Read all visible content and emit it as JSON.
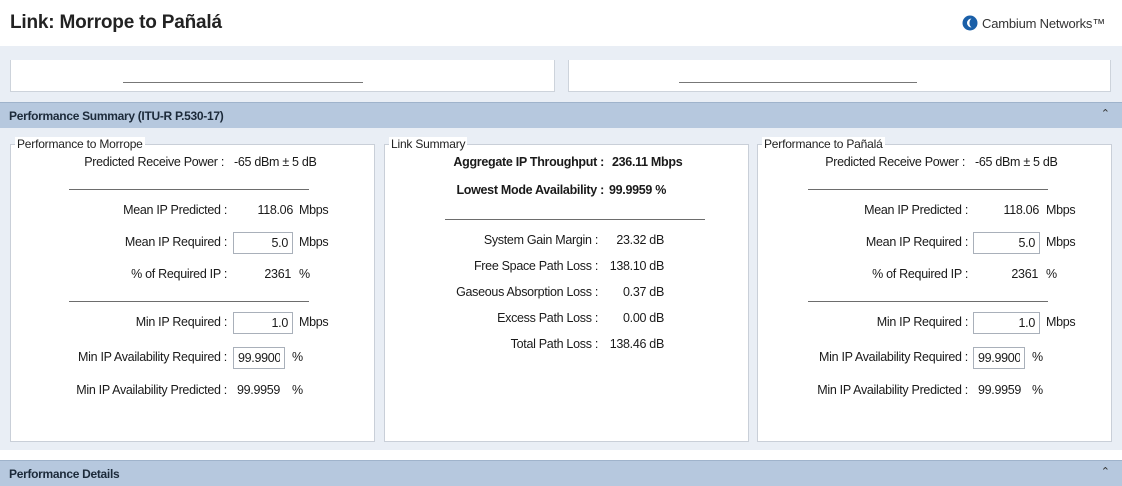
{
  "header": {
    "title": "Link: Morrope to Pañalá",
    "brand": "Cambium Networks™",
    "brand_color": "#1a5fa8"
  },
  "performance_summary": {
    "title": "Performance Summary (ITU-R P.530-17)",
    "collapse_icon": "double-chevron-up-icon"
  },
  "left_panel": {
    "title": "Performance to Morrope",
    "predicted_receive_power_label": "Predicted Receive Power :",
    "predicted_receive_power_value": "-65 dBm ± 5 dB",
    "mean_ip_predicted_label": "Mean IP Predicted :",
    "mean_ip_predicted_value": "118.06",
    "mean_ip_predicted_unit": "Mbps",
    "mean_ip_required_label": "Mean IP Required :",
    "mean_ip_required_value": "5.0",
    "mean_ip_required_unit": "Mbps",
    "pct_required_ip_label": "% of Required IP :",
    "pct_required_ip_value": "2361",
    "pct_required_ip_unit": "%",
    "min_ip_required_label": "Min IP Required :",
    "min_ip_required_value": "1.0",
    "min_ip_required_unit": "Mbps",
    "min_ip_avail_required_label": "Min IP Availability Required :",
    "min_ip_avail_required_value": "99.9900",
    "min_ip_avail_required_unit": "%",
    "min_ip_avail_predicted_label": "Min IP Availability Predicted :",
    "min_ip_avail_predicted_value": "99.9959",
    "min_ip_avail_predicted_unit": "%"
  },
  "link_summary": {
    "title": "Link Summary",
    "aggregate_label": "Aggregate IP Throughput :",
    "aggregate_value": "236.11 Mbps",
    "lowest_mode_label": "Lowest Mode Availability :",
    "lowest_mode_value": "99.9959 %",
    "system_gain_label": "System Gain Margin :",
    "system_gain_value": "23.32 dB",
    "fspl_label": "Free Space Path Loss :",
    "fspl_value": "138.10 dB",
    "gaseous_label": "Gaseous Absorption Loss :",
    "gaseous_value": "0.37 dB",
    "excess_label": "Excess Path Loss :",
    "excess_value": "0.00 dB",
    "total_label": "Total Path Loss :",
    "total_value": "138.46 dB"
  },
  "right_panel": {
    "title": "Performance to Pañalá",
    "predicted_receive_power_label": "Predicted Receive Power :",
    "predicted_receive_power_value": "-65 dBm ± 5 dB",
    "mean_ip_predicted_label": "Mean IP Predicted :",
    "mean_ip_predicted_value": "118.06",
    "mean_ip_predicted_unit": "Mbps",
    "mean_ip_required_label": "Mean IP Required :",
    "mean_ip_required_value": "5.0",
    "mean_ip_required_unit": "Mbps",
    "pct_required_ip_label": "% of Required IP :",
    "pct_required_ip_value": "2361",
    "pct_required_ip_unit": "%",
    "min_ip_required_label": "Min IP Required :",
    "min_ip_required_value": "1.0",
    "min_ip_required_unit": "Mbps",
    "min_ip_avail_required_label": "Min IP Availability Required :",
    "min_ip_avail_required_value": "99.9900",
    "min_ip_avail_required_unit": "%",
    "min_ip_avail_predicted_label": "Min IP Availability Predicted :",
    "min_ip_avail_predicted_value": "99.9959",
    "min_ip_avail_predicted_unit": "%"
  },
  "performance_details": {
    "title": "Performance Details",
    "collapse_icon": "double-chevron-up-icon"
  }
}
